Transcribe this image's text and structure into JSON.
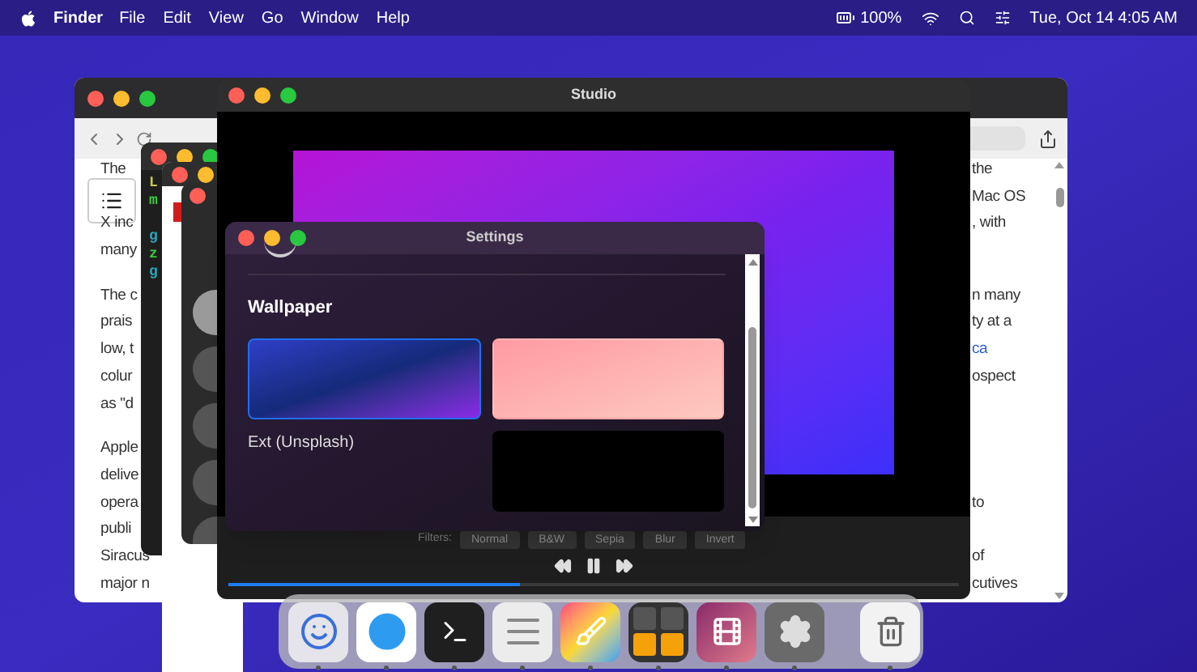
{
  "menu_bar": {
    "app_name": "Finder",
    "menus": [
      "File",
      "Edit",
      "View",
      "Go",
      "Window",
      "Help"
    ],
    "battery": "100%",
    "clock": "Tue, Oct 14 4:05 AM"
  },
  "browser": {
    "paragraphs": [
      [
        {
          "left": "The",
          "right": "the"
        },
        {
          "right": "Mac OS"
        },
        {
          "left": "X inc",
          "right": ", with"
        },
        {
          "left": "many"
        }
      ],
      [
        {
          "left": "The c",
          "right": "n many"
        },
        {
          "left": "prais",
          "right": "ty at a"
        },
        {
          "left": "low, t",
          "right": "ca",
          "right_link": true
        },
        {
          "left": "colur",
          "right": "ospect"
        },
        {
          "left": "as \"d"
        }
      ],
      [
        {
          "left": "Apple"
        },
        {
          "left": "delive"
        },
        {
          "left": "opera",
          "right": "to"
        },
        {
          "left": "publi"
        },
        {
          "left": "Siracus",
          "right": "of"
        },
        {
          "left": "major n",
          "right": "cutives"
        }
      ]
    ]
  },
  "terminal": {
    "lines": [
      {
        "text": "L",
        "color": "#c8c850"
      },
      {
        "text": "m",
        "color": "#3cc83c"
      },
      {
        "text": "g",
        "color": "#2aa6b8"
      },
      {
        "text": "z",
        "color": "#3cc83c"
      },
      {
        "text": "g",
        "color": "#2aa6b8"
      }
    ]
  },
  "studio": {
    "title": "Studio",
    "filters_label": "Filters:",
    "filters": [
      "Normal",
      "B&W",
      "Sepia",
      "Blur",
      "Invert"
    ],
    "progress": {
      "level": 0.4
    }
  },
  "settings": {
    "title": "Settings",
    "heading": "Wallpaper",
    "tiles": [
      {
        "kind": "blue",
        "selected": true
      },
      {
        "kind": "pink",
        "selected": false
      },
      {
        "kind": "caption",
        "text": "Ext (Unsplash)"
      },
      {
        "kind": "black",
        "selected": false
      }
    ]
  },
  "dock": {
    "apps": [
      {
        "kind": "finder",
        "running": true
      },
      {
        "kind": "compass",
        "running": true
      },
      {
        "kind": "terminal",
        "running": true
      },
      {
        "kind": "notes",
        "running": true
      },
      {
        "kind": "paint",
        "running": true
      },
      {
        "kind": "grid",
        "running": true
      },
      {
        "kind": "film",
        "running": true
      },
      {
        "kind": "settings",
        "running": true
      },
      {
        "kind": "trash",
        "running": true
      }
    ]
  }
}
